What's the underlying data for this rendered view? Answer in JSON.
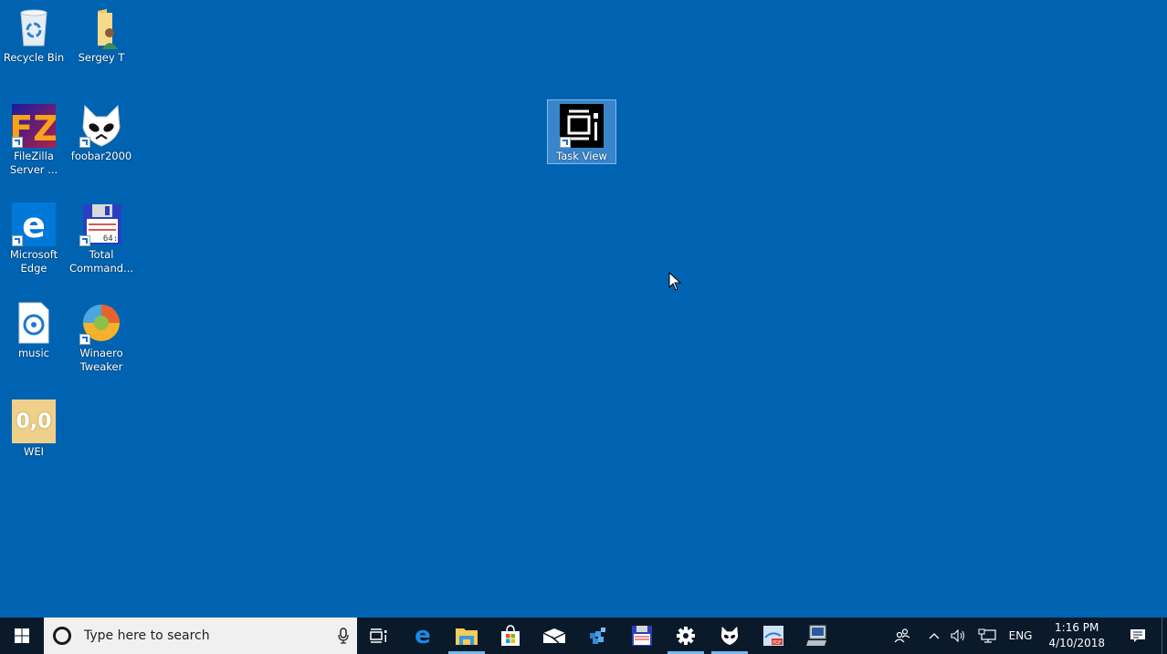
{
  "desktop": {
    "background_color": "#0063b1",
    "icons": [
      {
        "id": "recycle-bin",
        "label": "Recycle Bin",
        "shortcut": false,
        "selected": false
      },
      {
        "id": "user-folder",
        "label": "Sergey T",
        "shortcut": false,
        "selected": false
      },
      {
        "id": "filezilla-server",
        "label": "FileZilla Server ...",
        "shortcut": true,
        "selected": false
      },
      {
        "id": "foobar2000",
        "label": "foobar2000",
        "shortcut": true,
        "selected": false
      },
      {
        "id": "microsoft-edge",
        "label": "Microsoft Edge",
        "shortcut": true,
        "selected": false
      },
      {
        "id": "total-commander",
        "label": "Total Command...",
        "shortcut": true,
        "selected": false
      },
      {
        "id": "music",
        "label": "music",
        "shortcut": false,
        "selected": false
      },
      {
        "id": "winaero-tweaker",
        "label": "Winaero Tweaker",
        "shortcut": true,
        "selected": false
      },
      {
        "id": "wei",
        "label": "WEI",
        "shortcut": false,
        "selected": false,
        "glyph_text": "0,0"
      },
      {
        "id": "task-view-shortcut",
        "label": "Task View",
        "shortcut": true,
        "selected": true
      }
    ]
  },
  "taskbar": {
    "search_placeholder": "Type here to search",
    "pinned": [
      {
        "id": "task-view",
        "icon": "task-view-icon",
        "active": false
      },
      {
        "id": "edge",
        "icon": "edge-icon",
        "active": false
      },
      {
        "id": "file-explorer",
        "icon": "folder-icon",
        "active": true
      },
      {
        "id": "store",
        "icon": "store-icon",
        "active": false
      },
      {
        "id": "mail",
        "icon": "mail-icon",
        "active": false
      },
      {
        "id": "registry-editor",
        "icon": "registry-icon",
        "active": false
      },
      {
        "id": "total-commander",
        "icon": "floppy-icon",
        "active": false
      },
      {
        "id": "settings",
        "icon": "gear-icon",
        "active": true
      },
      {
        "id": "foobar2000",
        "icon": "foobar-icon",
        "active": true
      },
      {
        "id": "pdf-tool",
        "icon": "pdf-icon",
        "active": false
      },
      {
        "id": "this-pc",
        "icon": "computer-icon",
        "active": false
      }
    ],
    "tray": {
      "language": "ENG",
      "time": "1:16 PM",
      "date": "4/10/2018"
    },
    "accent_underline": "#76b9ed"
  }
}
